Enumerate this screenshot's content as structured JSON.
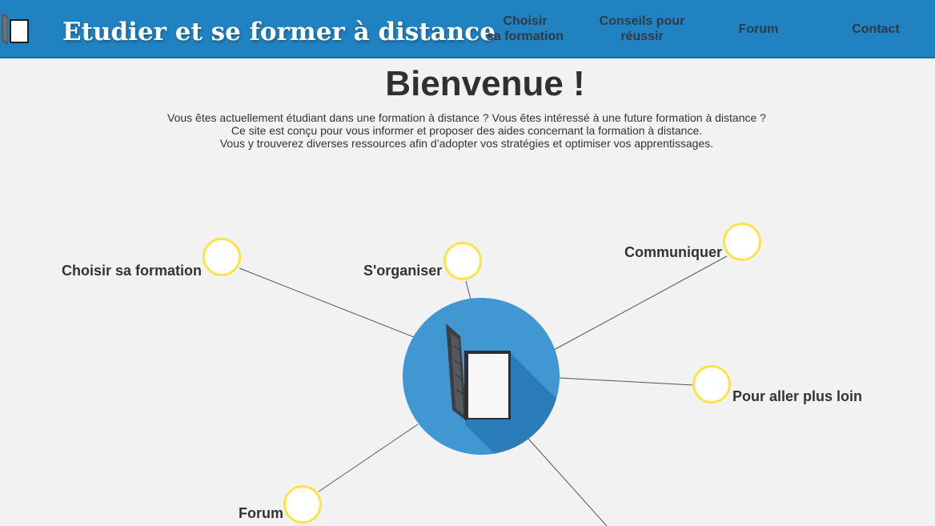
{
  "header": {
    "site_title": "Etudier et se former à distance",
    "background_color": "#2182c2",
    "logo_icon": "open-book-icon",
    "nav": [
      {
        "line1": "Choisir",
        "line2": "sa formation"
      },
      {
        "line1": "Conseils pour",
        "line2": "réussir"
      },
      {
        "line1": "Forum",
        "line2": ""
      },
      {
        "line1": "Contact",
        "line2": ""
      }
    ]
  },
  "welcome": {
    "title": "Bienvenue !",
    "lines": [
      "Vous êtes actuellement étudiant dans une formation à distance ? Vous êtes intéressé à une future formation à distance ?",
      "Ce site est conçu pour vous informer et proposer des aides concernant la formation à distance.",
      "Vous y trouverez diverses ressources afin d’adopter vos stratégies et optimiser vos apprentissages."
    ]
  },
  "mindmap": {
    "hub_color": "#4097d2",
    "node_border_color": "#fbe44a",
    "hub_icon": "open-book-icon",
    "nodes": [
      {
        "label": "Choisir sa formation"
      },
      {
        "label": "S'organiser"
      },
      {
        "label": "Communiquer"
      },
      {
        "label": "Pour aller plus loin"
      },
      {
        "label": "Forum"
      }
    ]
  }
}
